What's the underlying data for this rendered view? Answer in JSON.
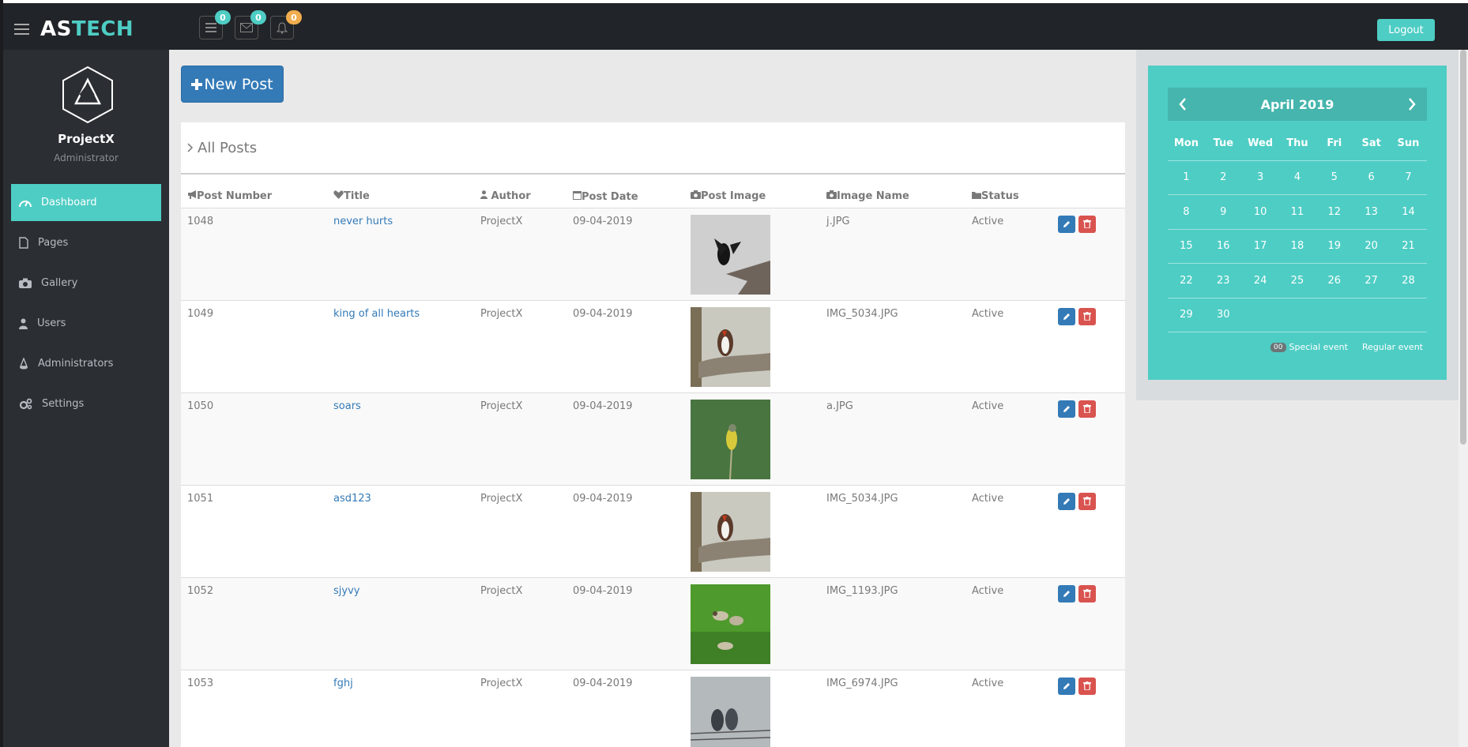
{
  "brand": {
    "part1": "AS",
    "part2": "TECH"
  },
  "topbar": {
    "badges": [
      "0",
      "0",
      "0"
    ],
    "logout_label": "Logout"
  },
  "profile": {
    "name": "ProjectX",
    "role": "Administrator"
  },
  "sidebar": {
    "items": [
      {
        "label": "Dashboard",
        "icon": "dashboard-icon"
      },
      {
        "label": "Pages",
        "icon": "file-icon"
      },
      {
        "label": "Gallery",
        "icon": "camera-icon"
      },
      {
        "label": "Users",
        "icon": "user-icon"
      },
      {
        "label": "Administrators",
        "icon": "admin-icon"
      },
      {
        "label": "Settings",
        "icon": "gears-icon"
      }
    ]
  },
  "main": {
    "new_post_label": "New Post",
    "panel_title": "All Posts",
    "columns": [
      "Post Number",
      "Title",
      "Author",
      "Post Date",
      "Post Image",
      "Image Name",
      "Status"
    ],
    "rows": [
      {
        "number": "1048",
        "title": "never hurts",
        "author": "ProjectX",
        "date": "09-04-2019",
        "image_name": "j.JPG",
        "status": "Active"
      },
      {
        "number": "1049",
        "title": "king of all hearts",
        "author": "ProjectX",
        "date": "09-04-2019",
        "image_name": "IMG_5034.JPG",
        "status": "Active"
      },
      {
        "number": "1050",
        "title": "soars",
        "author": "ProjectX",
        "date": "09-04-2019",
        "image_name": "a.JPG",
        "status": "Active"
      },
      {
        "number": "1051",
        "title": "asd123",
        "author": "ProjectX",
        "date": "09-04-2019",
        "image_name": "IMG_5034.JPG",
        "status": "Active"
      },
      {
        "number": "1052",
        "title": "sjyvy",
        "author": "ProjectX",
        "date": "09-04-2019",
        "image_name": "IMG_1193.JPG",
        "status": "Active"
      },
      {
        "number": "1053",
        "title": "fghj",
        "author": "ProjectX",
        "date": "09-04-2019",
        "image_name": "IMG_6974.JPG",
        "status": "Active"
      }
    ]
  },
  "calendar": {
    "month_label": "April 2019",
    "weekdays": [
      "Mon",
      "Tue",
      "Wed",
      "Thu",
      "Fri",
      "Sat",
      "Sun"
    ],
    "weeks": [
      [
        "1",
        "2",
        "3",
        "4",
        "5",
        "6",
        "7"
      ],
      [
        "8",
        "9",
        "10",
        "11",
        "12",
        "13",
        "14"
      ],
      [
        "15",
        "16",
        "17",
        "18",
        "19",
        "20",
        "21"
      ],
      [
        "22",
        "23",
        "24",
        "25",
        "26",
        "27",
        "28"
      ],
      [
        "29",
        "30",
        "",
        "",
        "",
        "",
        ""
      ]
    ],
    "legend_chip": "00",
    "legend_special": "Special event",
    "legend_regular": "Regular event"
  },
  "colors": {
    "accent": "#4ecdc4",
    "primary": "#337ab7",
    "danger": "#d9534f",
    "warning": "#f0ad4e",
    "topbar": "#212428",
    "sidebar": "#2b2e33"
  }
}
